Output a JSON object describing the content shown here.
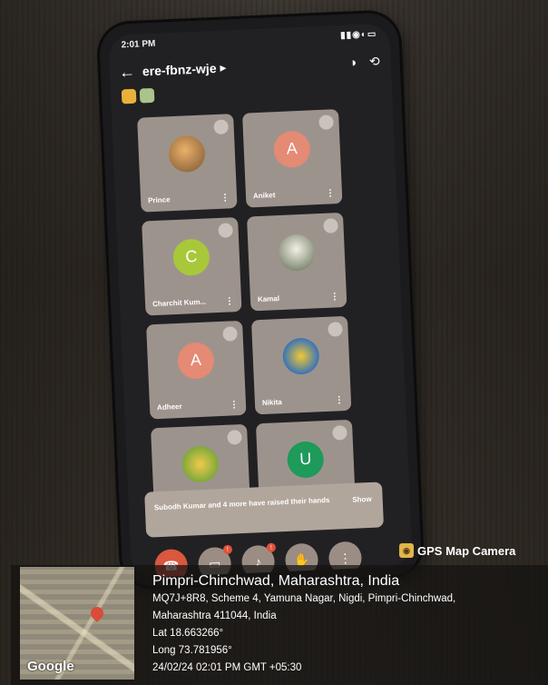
{
  "phone": {
    "status_time": "2:01 PM",
    "meeting_code": "ere-fbnz-wje",
    "participants": [
      {
        "name": "Prince",
        "avatar_letter": "",
        "avatar_kind": "photo"
      },
      {
        "name": "Aniket",
        "avatar_letter": "A",
        "avatar_kind": "letter"
      },
      {
        "name": "Charchit Kum...",
        "avatar_letter": "C",
        "avatar_kind": "letter"
      },
      {
        "name": "Kamal",
        "avatar_letter": "",
        "avatar_kind": "photo"
      },
      {
        "name": "Adheer",
        "avatar_letter": "A",
        "avatar_kind": "letter"
      },
      {
        "name": "Nikita",
        "avatar_letter": "",
        "avatar_kind": "photo"
      },
      {
        "name": "",
        "avatar_letter": "",
        "avatar_kind": "photo"
      },
      {
        "name": "",
        "avatar_letter": "U",
        "avatar_kind": "letter"
      }
    ],
    "raised_hands_message": "Subodh Kumar and 4 more have raised their hands",
    "raised_hands_action": "Show",
    "control_badge": "!"
  },
  "gps_overlay": {
    "app_label": "GPS Map Camera",
    "map_brand": "Google",
    "city": "Pimpri-Chinchwad, Maharashtra, India",
    "address_line1": "MQ7J+8R8, Scheme 4, Yamuna Nagar, Nigdi, Pimpri-Chinchwad,",
    "address_line2": "Maharashtra 411044, India",
    "lat": "Lat 18.663266°",
    "long": "Long 73.781956°",
    "datetime": "24/02/24 02:01 PM GMT +05:30"
  },
  "colors": {
    "tile_bg": "#9d938d",
    "end_call": "#d9583e",
    "overlay_bg": "rgba(20,18,16,0.72)"
  }
}
